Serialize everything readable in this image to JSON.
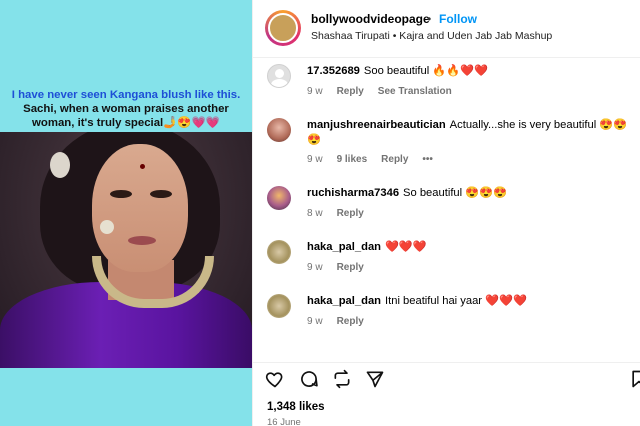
{
  "media": {
    "caption_line1": "I have never seen Kangana blush like this.",
    "caption_line2": "Sachi, when a woman praises another",
    "caption_line3": "woman, it's truly special🤳😍💗💗"
  },
  "header": {
    "username": "bollywoodvideopage",
    "separator": "•",
    "follow_label": "Follow",
    "audio": "Shashaa Tirupati • Kajra and Uden Jab Jab Mashup",
    "more_label": "..."
  },
  "comments": [
    {
      "username": "17.352689",
      "text": "Soo beautiful 🔥🔥❤️❤️",
      "time": "9 w",
      "reply": "Reply",
      "extra": "See Translation",
      "avatar": "default-avatar"
    },
    {
      "username": "manjushreenairbeautician",
      "text": "Actually...she is very beautiful 😍😍😍",
      "time": "9 w",
      "likes": "9 likes",
      "reply": "Reply",
      "extra": "•••",
      "avatar": "profile-photo"
    },
    {
      "username": "ruchisharma7346",
      "text": "So beautiful 😍😍😍",
      "time": "8 w",
      "reply": "Reply",
      "avatar": "profile-photo"
    },
    {
      "username": "haka_pal_dan",
      "text": "❤️❤️❤️",
      "time": "9 w",
      "reply": "Reply",
      "avatar": "profile-photo"
    },
    {
      "username": "haka_pal_dan",
      "text": "Itni beatiful hai yaar ❤️❤️❤️",
      "time": "9 w",
      "reply": "Reply",
      "avatar": "profile-photo"
    }
  ],
  "actions": {
    "icons": [
      "heart-icon",
      "comment-icon",
      "share-icon",
      "send-icon",
      "bookmark-icon"
    ]
  },
  "likes": "1,348 likes",
  "date": "16 June",
  "colors": {
    "media_bg": "#84e2ea",
    "caption_highlight": "#1e4fd6",
    "follow": "#0095f6",
    "meta": "#737373"
  }
}
